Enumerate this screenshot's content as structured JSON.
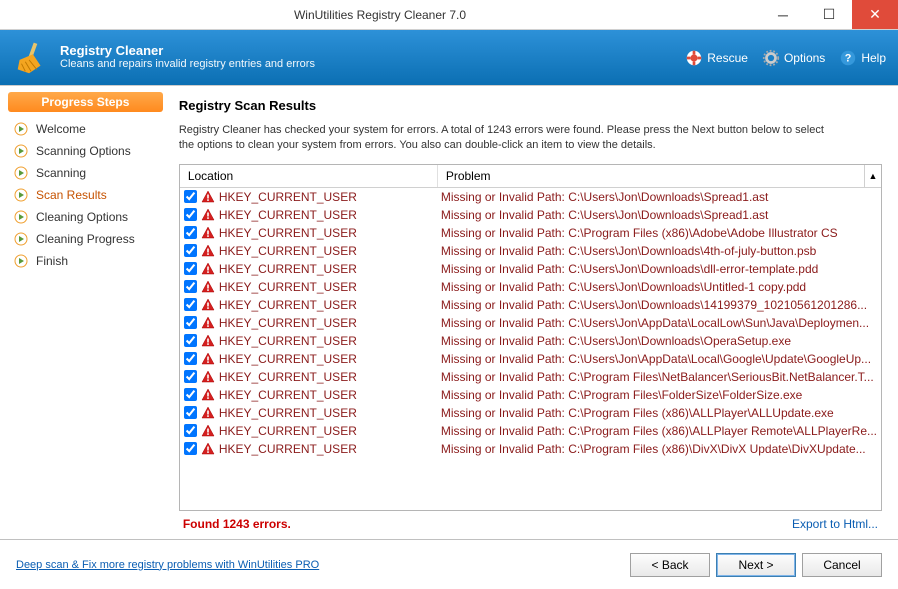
{
  "titlebar": {
    "title": "WinUtilities Registry Cleaner 7.0"
  },
  "header": {
    "title": "Registry Cleaner",
    "subtitle": "Cleans and repairs invalid registry entries and errors",
    "rescue": "Rescue",
    "options": "Options",
    "help": "Help"
  },
  "sidebar": {
    "header": "Progress Steps",
    "steps": [
      "Welcome",
      "Scanning Options",
      "Scanning",
      "Scan Results",
      "Cleaning Options",
      "Cleaning Progress",
      "Finish"
    ],
    "selected": 3
  },
  "main": {
    "title": "Registry Scan Results",
    "description": "Registry Cleaner has checked your system for errors. A total of 1243 errors were found. Please press the Next button below to select the options to clean your system from errors. You also can double-click an item to view the details.",
    "col_location": "Location",
    "col_problem": "Problem",
    "rows": [
      {
        "loc": "HKEY_CURRENT_USER",
        "prob": "Missing or Invalid Path: C:\\Users\\Jon\\Downloads\\Spread1.ast"
      },
      {
        "loc": "HKEY_CURRENT_USER",
        "prob": "Missing or Invalid Path: C:\\Users\\Jon\\Downloads\\Spread1.ast"
      },
      {
        "loc": "HKEY_CURRENT_USER",
        "prob": "Missing or Invalid Path: C:\\Program Files (x86)\\Adobe\\Adobe Illustrator CS"
      },
      {
        "loc": "HKEY_CURRENT_USER",
        "prob": "Missing or Invalid Path: C:\\Users\\Jon\\Downloads\\4th-of-july-button.psb"
      },
      {
        "loc": "HKEY_CURRENT_USER",
        "prob": "Missing or Invalid Path: C:\\Users\\Jon\\Downloads\\dll-error-template.pdd"
      },
      {
        "loc": "HKEY_CURRENT_USER",
        "prob": "Missing or Invalid Path: C:\\Users\\Jon\\Downloads\\Untitled-1 copy.pdd"
      },
      {
        "loc": "HKEY_CURRENT_USER",
        "prob": "Missing or Invalid Path: C:\\Users\\Jon\\Downloads\\14199379_10210561201286..."
      },
      {
        "loc": "HKEY_CURRENT_USER",
        "prob": "Missing or Invalid Path: C:\\Users\\Jon\\AppData\\LocalLow\\Sun\\Java\\Deploymen..."
      },
      {
        "loc": "HKEY_CURRENT_USER",
        "prob": "Missing or Invalid Path: C:\\Users\\Jon\\Downloads\\OperaSetup.exe"
      },
      {
        "loc": "HKEY_CURRENT_USER",
        "prob": "Missing or Invalid Path: C:\\Users\\Jon\\AppData\\Local\\Google\\Update\\GoogleUp..."
      },
      {
        "loc": "HKEY_CURRENT_USER",
        "prob": "Missing or Invalid Path: C:\\Program Files\\NetBalancer\\SeriousBit.NetBalancer.T..."
      },
      {
        "loc": "HKEY_CURRENT_USER",
        "prob": "Missing or Invalid Path: C:\\Program Files\\FolderSize\\FolderSize.exe"
      },
      {
        "loc": "HKEY_CURRENT_USER",
        "prob": "Missing or Invalid Path: C:\\Program Files (x86)\\ALLPlayer\\ALLUpdate.exe"
      },
      {
        "loc": "HKEY_CURRENT_USER",
        "prob": "Missing or Invalid Path: C:\\Program Files (x86)\\ALLPlayer Remote\\ALLPlayerRe..."
      },
      {
        "loc": "HKEY_CURRENT_USER",
        "prob": "Missing or Invalid Path: C:\\Program Files (x86)\\DivX\\DivX Update\\DivXUpdate..."
      }
    ],
    "found": "Found 1243 errors.",
    "export": "Export to Html..."
  },
  "footer": {
    "pro_link": "Deep scan & Fix more registry problems with WinUtilities PRO",
    "back": "< Back",
    "next": "Next >",
    "cancel": "Cancel"
  }
}
